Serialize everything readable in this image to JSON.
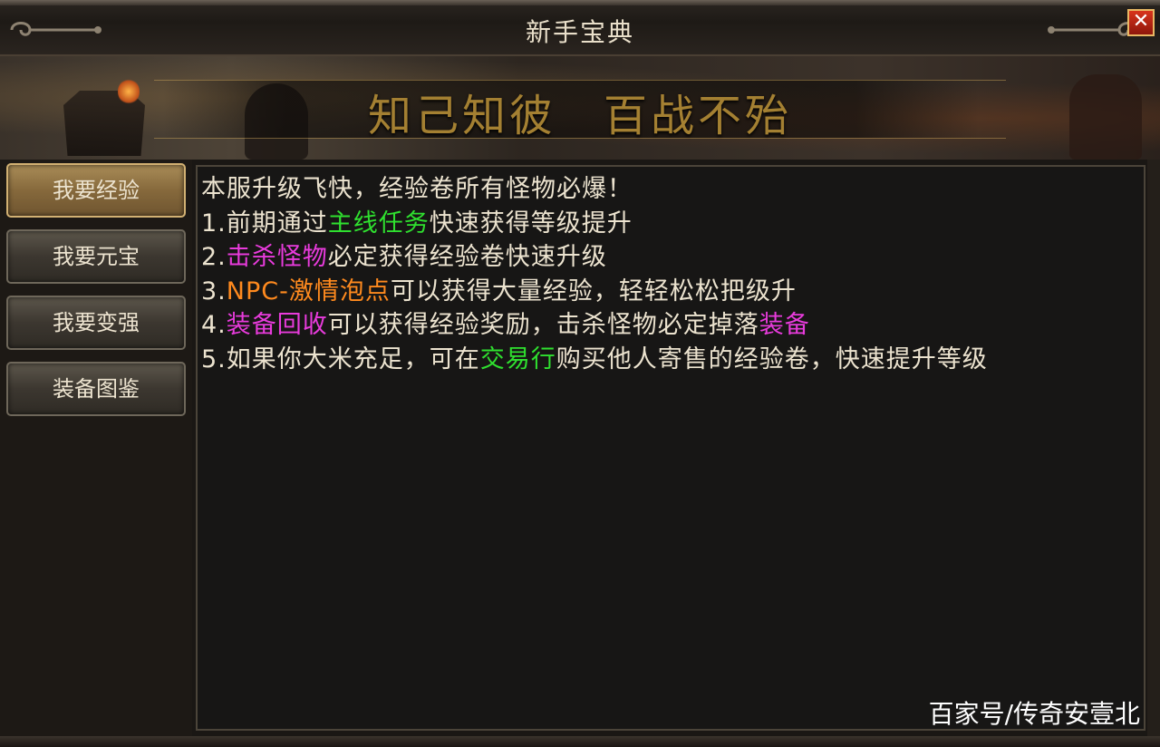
{
  "window": {
    "title": "新手宝典",
    "close_label": "✕"
  },
  "banner": {
    "slogan": "知己知彼　百战不殆"
  },
  "sidebar": {
    "items": [
      {
        "label": "我要经验",
        "active": true
      },
      {
        "label": "我要元宝",
        "active": false
      },
      {
        "label": "我要变强",
        "active": false
      },
      {
        "label": "装备图鉴",
        "active": false
      }
    ]
  },
  "content": {
    "lines": [
      [
        {
          "text": "本服升级飞快，经验卷所有怪物必爆！",
          "color": "#ece3cf"
        }
      ],
      [
        {
          "text": "1.前期通过",
          "color": "#ece3cf"
        },
        {
          "text": "主线任务",
          "color": "#2fe02f"
        },
        {
          "text": "快速获得等级提升",
          "color": "#ece3cf"
        }
      ],
      [
        {
          "text": "2.",
          "color": "#ece3cf"
        },
        {
          "text": "击杀怪物",
          "color": "#e83bdc"
        },
        {
          "text": "必定获得经验卷快速升级",
          "color": "#ece3cf"
        }
      ],
      [
        {
          "text": "3.",
          "color": "#ece3cf"
        },
        {
          "text": "NPC-激情泡点",
          "color": "#ff8a1e"
        },
        {
          "text": "可以获得大量经验，轻轻松松把级升",
          "color": "#ece3cf"
        }
      ],
      [
        {
          "text": "4.",
          "color": "#ece3cf"
        },
        {
          "text": "装备回收",
          "color": "#e83bdc"
        },
        {
          "text": "可以获得经验奖励，击杀怪物必定掉落",
          "color": "#ece3cf"
        },
        {
          "text": "装备",
          "color": "#e83bdc"
        }
      ],
      [
        {
          "text": "5.如果你大米充足，可在",
          "color": "#ece3cf"
        },
        {
          "text": "交易行",
          "color": "#2fe02f"
        },
        {
          "text": "购买他人寄售的经验卷，快速提升等级",
          "color": "#ece3cf"
        }
      ]
    ]
  },
  "watermark": "百家号/传奇安壹北",
  "colors": {
    "green_highlight": "#2fe02f",
    "magenta_highlight": "#e83bdc",
    "orange_highlight": "#ff8a1e",
    "active_tab": "#86693c"
  }
}
